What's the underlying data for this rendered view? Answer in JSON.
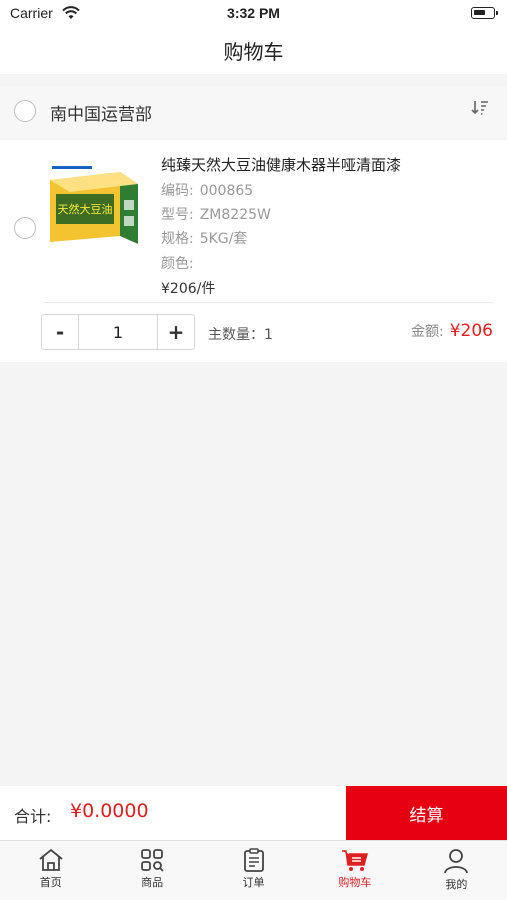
{
  "status_bar": {
    "carrier": "Carrier",
    "time": "3:32 PM"
  },
  "nav": {
    "title": "购物车"
  },
  "group": {
    "name": "南中国运营部"
  },
  "item": {
    "name": "纯臻天然大豆油健康木器半哑清面漆",
    "attributes": [
      {
        "label": "编码:",
        "value": "000865"
      },
      {
        "label": "型号:",
        "value": "ZM8225W"
      },
      {
        "label": "规格:",
        "value": "5KG/套"
      },
      {
        "label": "颜色:",
        "value": ""
      }
    ],
    "unit_price": "¥206/件",
    "stepper": {
      "minus": "-",
      "quantity": "1",
      "plus": "+"
    },
    "main_quantity": "主数量：1",
    "amount_label": "金额:",
    "amount_value": "¥206",
    "thumb_text": "天然大豆油"
  },
  "footer": {
    "total_label": "合计:",
    "total_value": "¥0.0000",
    "checkout_label": "结算"
  },
  "tabs": [
    {
      "label": "首页",
      "icon": "home-icon"
    },
    {
      "label": "商品",
      "icon": "products-icon"
    },
    {
      "label": "订单",
      "icon": "orders-icon"
    },
    {
      "label": "购物车",
      "icon": "cart-icon",
      "active": true
    },
    {
      "label": "我的",
      "icon": "profile-icon"
    }
  ],
  "colors": {
    "accent": "#e60012",
    "price": "#e02020"
  }
}
